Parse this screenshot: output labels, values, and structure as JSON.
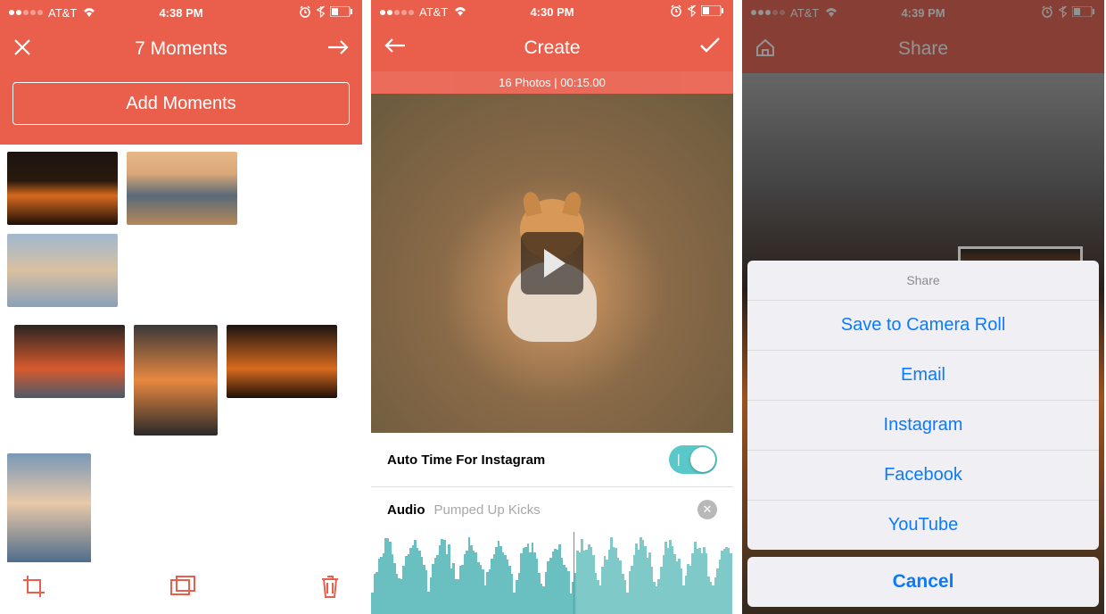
{
  "screen1": {
    "status": {
      "carrier": "AT&T",
      "time": "4:38 PM"
    },
    "title": "7 Moments",
    "add_button": "Add Moments"
  },
  "screen2": {
    "status": {
      "carrier": "AT&T",
      "time": "4:30 PM"
    },
    "title": "Create",
    "info": "16 Photos | 00:15.00",
    "auto_label": "Auto Time For Instagram",
    "audio_label": "Audio",
    "audio_track": "Pumped Up Kicks"
  },
  "screen3": {
    "status": {
      "carrier": "AT&T",
      "time": "4:39 PM"
    },
    "title": "Share",
    "sheet_title": "Share",
    "options": {
      "o1": "Save to Camera Roll",
      "o2": "Email",
      "o3": "Instagram",
      "o4": "Facebook",
      "o5": "YouTube"
    },
    "cancel": "Cancel"
  }
}
